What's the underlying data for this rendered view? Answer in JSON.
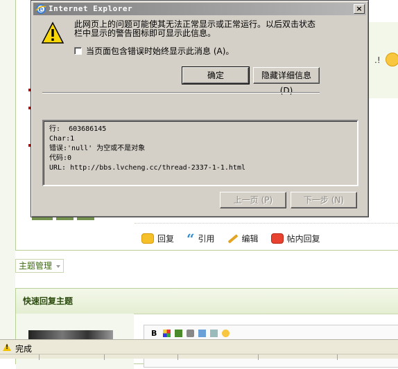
{
  "dialog": {
    "title": "Internet Explorer",
    "close_label": "×",
    "message_line1": "此网页上的问题可能使其无法正常显示或正常运行。以后双击状态",
    "message_line2": "栏中显示的警告图标即可显示此信息。",
    "checkbox_label": "当页面包含错误时始终显示此消息 (A)。",
    "checkbox_checked": false,
    "ok_label": "确定",
    "hide_details_label": "隐藏详细信息 (D)",
    "prev_label": "上一页 (P)",
    "next_label": "下一步 (N)",
    "details": {
      "line_label": "行:",
      "line_value": "603686145",
      "char_label": "Char:",
      "char_value": "1",
      "error_label": "错误:",
      "error_value": "'null' 为空或不是对象",
      "code_label": "代码:",
      "code_value": "0",
      "url_label": "URL:",
      "url_value": "http://bbs.lvcheng.cc/thread-2337-1-1.html"
    }
  },
  "post_actions": {
    "reply": "回复",
    "quote": "引用",
    "edit": "编辑",
    "floor_reply": "帖内回复"
  },
  "theme_management": "主题管理",
  "quick_reply_title": "快速回复主题",
  "background_fragment": ".!",
  "status_bar": {
    "text": "完成"
  },
  "colors": {
    "dialog_bg": "#d4d0c8",
    "titlebar_inactive": "#808080",
    "forum_green": "#3d6b10",
    "warning_yellow": "#f3c300"
  }
}
